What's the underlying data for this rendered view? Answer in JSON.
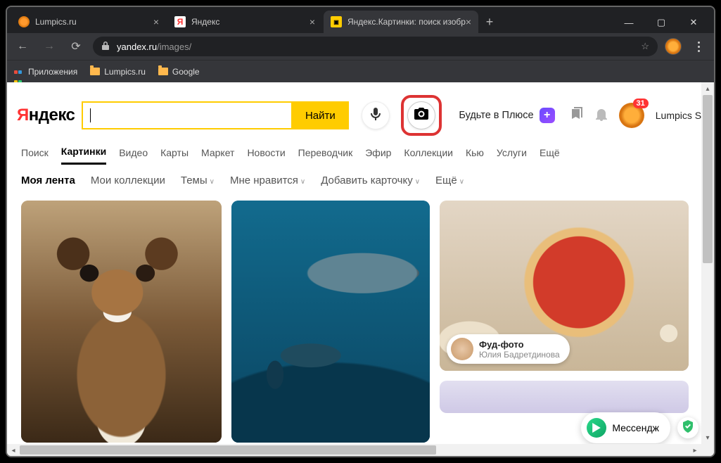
{
  "window": {
    "tabs": [
      {
        "title": "Lumpics.ru",
        "active": false
      },
      {
        "title": "Яндекс",
        "active": false
      },
      {
        "title": "Яндекс.Картинки: поиск изобра",
        "active": true
      }
    ]
  },
  "address": {
    "domain": "yandex.ru",
    "path": "/images/"
  },
  "bookmarks": {
    "apps": "Приложения",
    "items": [
      "Lumpics.ru",
      "Google"
    ]
  },
  "header": {
    "logo_red": "Я",
    "logo_rest": "ндекс",
    "search_value": "",
    "search_button": "Найти",
    "plus_text": "Будьте в Плюсе",
    "notif_count": "31",
    "user_name": "Lumpics S."
  },
  "nav": {
    "items": [
      "Поиск",
      "Картинки",
      "Видео",
      "Карты",
      "Маркет",
      "Новости",
      "Переводчик",
      "Эфир",
      "Коллекции",
      "Кью",
      "Услуги",
      "Ещё"
    ],
    "active_index": 1
  },
  "secondary": {
    "my_feed": "Моя лента",
    "my_collections": "Мои коллекции",
    "topics": "Темы",
    "likes": "Мне нравится",
    "add_card": "Добавить карточку",
    "more": "Ещё"
  },
  "cards": {
    "author": {
      "title": "Фуд-фото",
      "subtitle": "Юлия Бадретдинова"
    }
  },
  "messenger": {
    "label": "Мессендж"
  }
}
